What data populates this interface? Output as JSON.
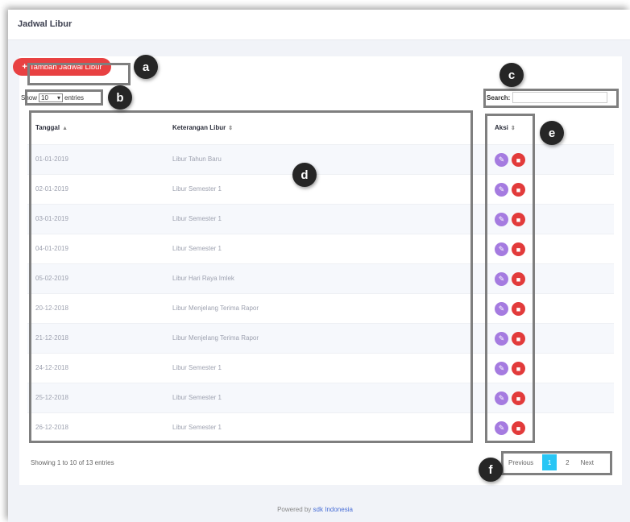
{
  "header": {
    "title": "Jadwal Libur"
  },
  "toolbar": {
    "add_label": "Tambah Jadwal Libur"
  },
  "length_menu": {
    "show": "Show",
    "value": "10",
    "entries": "entries"
  },
  "search": {
    "label": "Search:",
    "value": ""
  },
  "table": {
    "columns": [
      "Tanggal",
      "Keterangan Libur",
      "Aksi"
    ],
    "rows": [
      [
        "01-01-2019",
        "Libur Tahun Baru"
      ],
      [
        "02-01-2019",
        "Libur Semester 1"
      ],
      [
        "03-01-2019",
        "Libur Semester 1"
      ],
      [
        "04-01-2019",
        "Libur Semester 1"
      ],
      [
        "05-02-2019",
        "Libur Hari Raya Imlek"
      ],
      [
        "20-12-2018",
        "Libur Menjelang Terima Rapor"
      ],
      [
        "21-12-2018",
        "Libur Menjelang Terima Rapor"
      ],
      [
        "24-12-2018",
        "Libur Semester 1"
      ],
      [
        "25-12-2018",
        "Libur Semester 1"
      ],
      [
        "26-12-2018",
        "Libur Semester 1"
      ]
    ]
  },
  "info": "Showing 1 to 10 of 13 entries",
  "pagination": {
    "previous": "Previous",
    "pages": [
      "1",
      "2"
    ],
    "next": "Next",
    "current": "1"
  },
  "footer": {
    "text": "Powered by",
    "brand": "sdk Indonesia"
  },
  "annotations": [
    "a",
    "b",
    "c",
    "d",
    "e",
    "f"
  ],
  "colors": {
    "add_button": "#e84142",
    "edit_button": "#a57be0",
    "delete_button": "#e23b3b",
    "active_page": "#29c6f5"
  }
}
